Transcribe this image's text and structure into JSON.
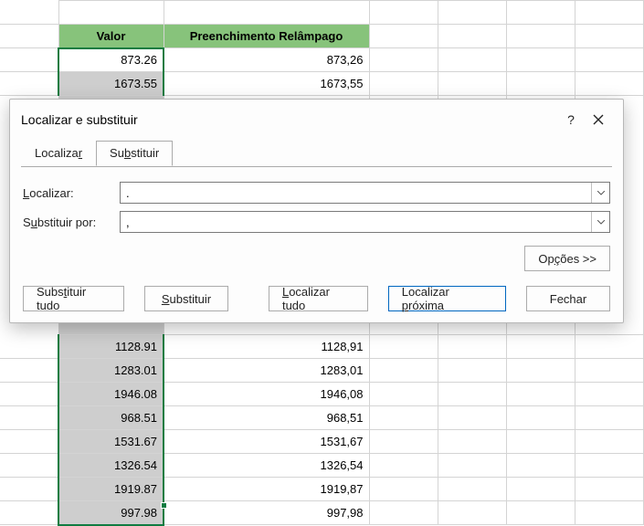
{
  "headers": {
    "colA": "Valor",
    "colB": "Preenchimento Relâmpago"
  },
  "rows_top": [
    {
      "a": "873.26",
      "b": "873,26"
    },
    {
      "a": "1673.55",
      "b": "1673,55"
    }
  ],
  "rows_bottom": [
    {
      "a": "1128.91",
      "b": "1128,91"
    },
    {
      "a": "1283.01",
      "b": "1283,01"
    },
    {
      "a": "1946.08",
      "b": "1946,08"
    },
    {
      "a": "968.51",
      "b": "968,51"
    },
    {
      "a": "1531.67",
      "b": "1531,67"
    },
    {
      "a": "1326.54",
      "b": "1326,54"
    },
    {
      "a": "1919.87",
      "b": "1919,87"
    },
    {
      "a": "997.98",
      "b": "997,98"
    }
  ],
  "dialog": {
    "title": "Localizar e substituir",
    "help": "?",
    "tabs": {
      "find": "Localizar",
      "replace": "Substituir",
      "find_u": "r",
      "replace_u": "b"
    },
    "labels": {
      "find": "Localizar:",
      "find_u": "L",
      "replace": "Substituir por:",
      "replace_u": "u"
    },
    "values": {
      "find": ".",
      "replace": ","
    },
    "options": "Opções >>",
    "options_u": "ç",
    "buttons": {
      "replace_all": "Substituir tudo",
      "replace_all_u": "t",
      "replace": "Substituir",
      "replace_u": "S",
      "find_all": "Localizar tudo",
      "find_all_u": "L",
      "find_next": "Localizar próxima",
      "find_next_u": "p",
      "close": "Fechar"
    }
  }
}
